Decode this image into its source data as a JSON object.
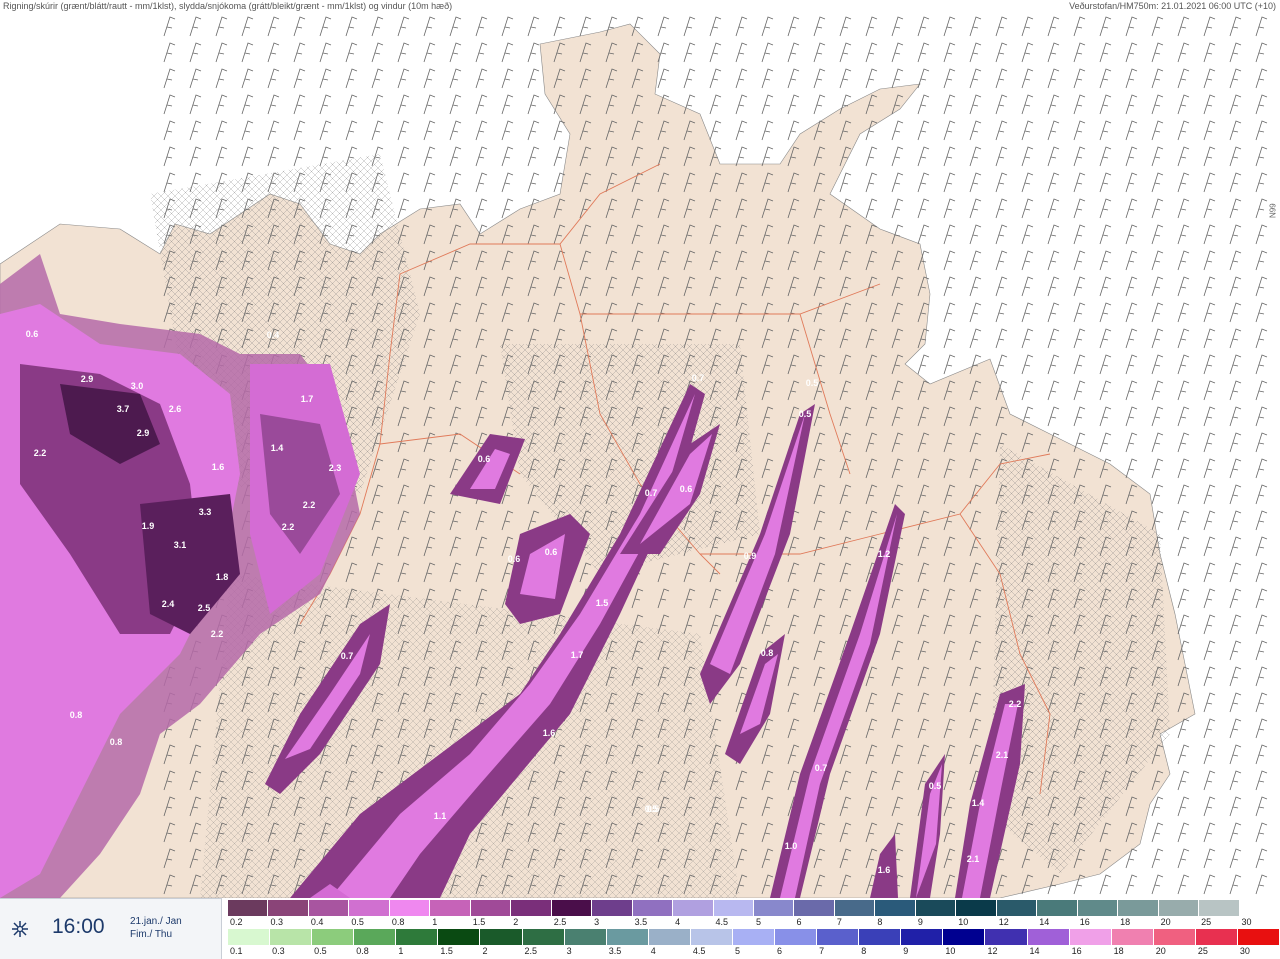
{
  "header": {
    "left_title": "Rigning/skúrir (grænt/blátt/rautt - mm/1klst), slydda/snjókoma (grátt/bleikt/grænt - mm/1klst) og vindur (10m hæð)",
    "right_title": "Veðurstofan/HM750m: 21.01.2021 06:00 UTC (+10)"
  },
  "grid_label": "66N",
  "time_panel": {
    "time": "16:00",
    "date_line1": "21.jan./ Jan",
    "date_line2": "Fim./ Thu",
    "icon": "snow-wind-icon"
  },
  "legend": {
    "snow_row": {
      "labels": [
        "0.2",
        "0.3",
        "0.4",
        "0.5",
        "0.8",
        "1",
        "1.5",
        "2",
        "2.5",
        "3",
        "3.5",
        "4",
        "4.5",
        "5",
        "6",
        "7",
        "8",
        "9",
        "10",
        "12",
        "14",
        "16",
        "18",
        "20",
        "25",
        "30"
      ],
      "colors": [
        "#6b3a5e",
        "#8a4478",
        "#a855a0",
        "#d070d0",
        "#ef88ef",
        "#c663b8",
        "#a04a98",
        "#7a2f7a",
        "#4a0e4a",
        "#6e3e8c",
        "#9070c0",
        "#b0a0e0",
        "#b8b8f0",
        "#8888cc",
        "#6a6aaa",
        "#486a8a",
        "#2a5a7a",
        "#1a4a5a",
        "#0a3a4a",
        "#2a5a6a",
        "#4a7a7a",
        "#608a8a",
        "#7a9a9a",
        "#98acac",
        "#b8c4c4",
        "#ffffff"
      ]
    },
    "rain_row": {
      "labels": [
        "0.1",
        "0.3",
        "0.5",
        "0.8",
        "1",
        "1.5",
        "2",
        "2.5",
        "3",
        "3.5",
        "4",
        "4.5",
        "5",
        "6",
        "7",
        "8",
        "9",
        "10",
        "12",
        "14",
        "16",
        "18",
        "20",
        "25",
        "30"
      ],
      "colors": [
        "#d8f8d0",
        "#b8e4a8",
        "#8ccc7c",
        "#5aa85a",
        "#2e7a3a",
        "#0a4a12",
        "#1a5a2a",
        "#2e6e44",
        "#4a8070",
        "#6a9aa0",
        "#9ab0c8",
        "#b8c4e8",
        "#a8b0f4",
        "#8890e8",
        "#5a60cc",
        "#3a40b8",
        "#2020a8",
        "#000090",
        "#4030b0",
        "#a060d8",
        "#f0a0e8",
        "#f080b0",
        "#f06080",
        "#e83050",
        "#e81010"
      ]
    }
  },
  "map": {
    "land_color": "#f2e2d3",
    "sea_color": "#ffffff",
    "road_color": "#e07a5a",
    "precip_labels": [
      {
        "v": "0.6"
      },
      {
        "v": "2.9"
      },
      {
        "v": "3.0"
      },
      {
        "v": "3.7"
      },
      {
        "v": "2.6"
      },
      {
        "v": "2.9"
      },
      {
        "v": "2.2"
      },
      {
        "v": "0.4"
      },
      {
        "v": "1.7"
      },
      {
        "v": "1.4"
      },
      {
        "v": "1.6"
      },
      {
        "v": "2.3"
      },
      {
        "v": "2.2"
      },
      {
        "v": "3.3"
      },
      {
        "v": "1.9"
      },
      {
        "v": "2.2"
      },
      {
        "v": "3.1"
      },
      {
        "v": "1.8"
      },
      {
        "v": "2.4"
      },
      {
        "v": "2.5"
      },
      {
        "v": "2.2"
      },
      {
        "v": "0.6"
      },
      {
        "v": "0.6"
      },
      {
        "v": "0.6"
      },
      {
        "v": "0.7"
      },
      {
        "v": "0.6"
      },
      {
        "v": "0.7"
      },
      {
        "v": "0.5"
      },
      {
        "v": "0.5"
      },
      {
        "v": "0.9"
      },
      {
        "v": "1.2"
      },
      {
        "v": "1.5"
      },
      {
        "v": "1.7"
      },
      {
        "v": "0.7"
      },
      {
        "v": "0.8"
      },
      {
        "v": "0.8"
      },
      {
        "v": "0.8"
      },
      {
        "v": "1.6"
      },
      {
        "v": "0.7"
      },
      {
        "v": "0.5"
      },
      {
        "v": "1.1"
      },
      {
        "v": "0.5"
      },
      {
        "v": "1.0"
      },
      {
        "v": "2.2"
      },
      {
        "v": "2.1"
      },
      {
        "v": "1.4"
      },
      {
        "v": "0.5"
      },
      {
        "v": "2.1"
      },
      {
        "v": "1.6"
      }
    ]
  }
}
